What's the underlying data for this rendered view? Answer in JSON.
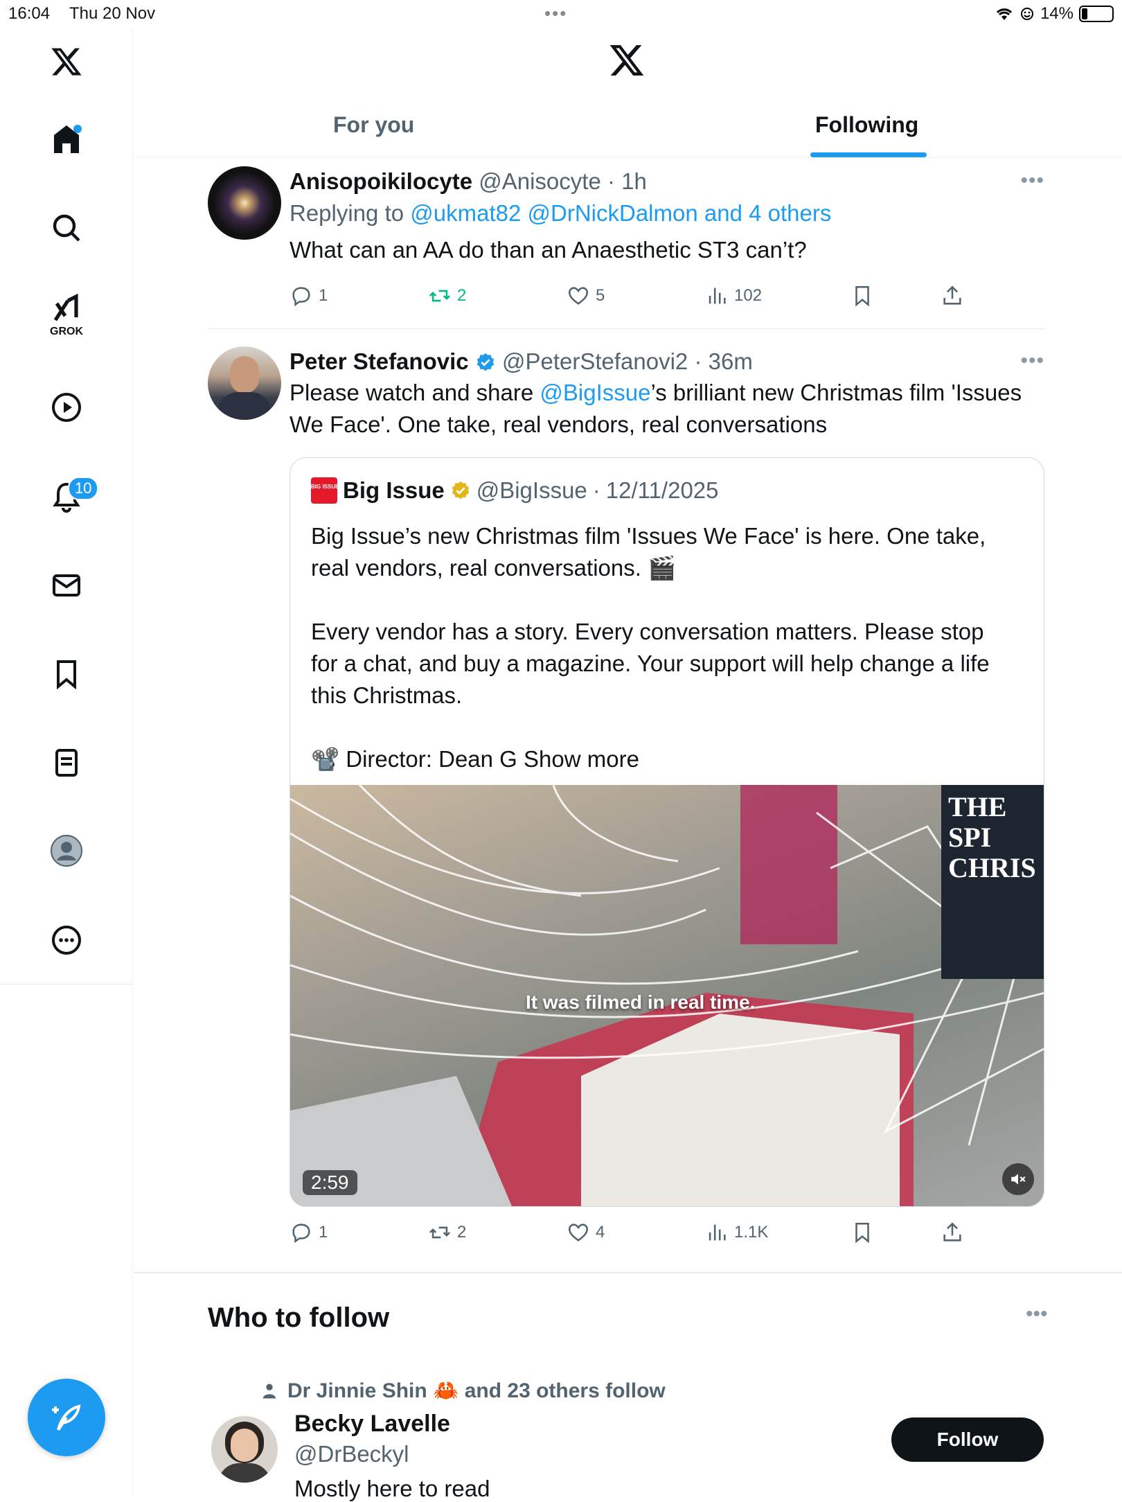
{
  "status_bar": {
    "time": "16:04",
    "date": "Thu 20 Nov",
    "battery": "14%"
  },
  "sidebar": {
    "grok_label": "GROK",
    "notifications_badge": "10"
  },
  "tabs": [
    {
      "label": "For you"
    },
    {
      "label": "Following"
    }
  ],
  "tweets": [
    {
      "name": "Anisopoikilocyte",
      "handle": "@Anisocyte",
      "time": "1h",
      "reply_prefix": "Replying to",
      "reply_mentions": "@ukmat82 @DrNickDalmon and 4 others",
      "text": "What can an AA do than an Anaesthetic ST3 can’t?",
      "replies": "1",
      "retweets": "2",
      "likes": "5",
      "views": "102"
    },
    {
      "name": "Peter Stefanovic",
      "handle": "@PeterStefanovi2",
      "time": "36m",
      "text_before": "Please watch and share ",
      "text_mention": "@BigIssue",
      "text_after": "’s brilliant new Christmas film 'Issues We Face'. One take, real vendors, real conversations",
      "quote": {
        "logo_text": "BIG ISSUE",
        "name": "Big Issue",
        "handle": "@BigIssue",
        "date": "12/11/2025",
        "para1": "Big Issue’s new Christmas film 'Issues We Face' is here. One take, real vendors, real conversations. 🎬",
        "para2": "Every vendor has a story. Every conversation matters. Please stop for a chat, and buy a magazine. Your support will help change a life this Christmas.",
        "para3": "📽️ Director: Dean G",
        "show_more": "Show more",
        "video_caption": "It was filmed in real time.",
        "video_sign": "THE SPI CHRIS",
        "duration": "2:59"
      },
      "replies": "1",
      "retweets": "2",
      "likes": "4",
      "views": "1.1K"
    }
  ],
  "who_to_follow": {
    "title": "Who to follow",
    "context": "Dr Jinnie Shin 🦀 and 23 others follow",
    "name": "Becky Lavelle",
    "handle": "@DrBeckyl",
    "bio": "Mostly here to read",
    "follow_label": "Follow"
  },
  "colors": {
    "accent": "#1d9bf0",
    "retweet_green": "#00ba7c",
    "text_secondary": "#536471"
  }
}
